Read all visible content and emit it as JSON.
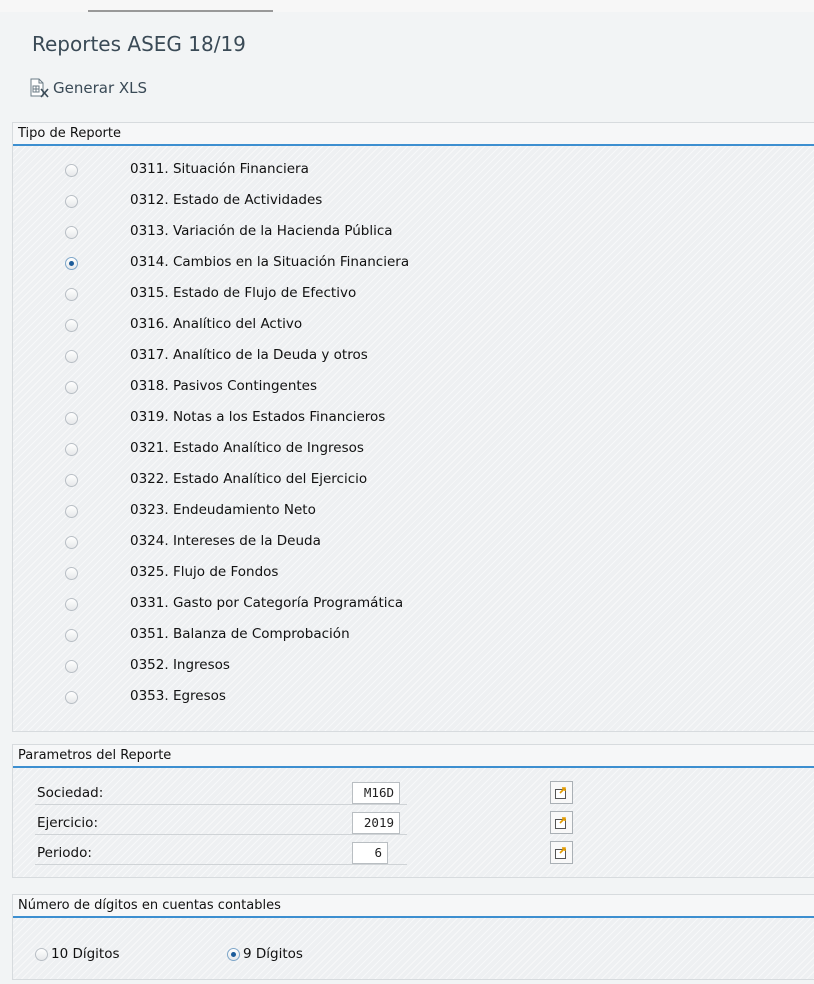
{
  "window": {
    "title": "Reportes ASEG 18/19"
  },
  "toolbar": {
    "generate_label": "Generar XLS",
    "icon": "excel-export-icon"
  },
  "report_type": {
    "title": "Tipo de Reporte",
    "selected": "0314",
    "options": [
      {
        "code": "0311",
        "label": "0311. Situación Financiera"
      },
      {
        "code": "0312",
        "label": "0312. Estado de Actividades"
      },
      {
        "code": "0313",
        "label": "0313. Variación de la Hacienda Pública"
      },
      {
        "code": "0314",
        "label": "0314. Cambios en la Situación Financiera"
      },
      {
        "code": "0315",
        "label": "0315. Estado de Flujo de Efectivo"
      },
      {
        "code": "0316",
        "label": "0316. Analítico del Activo"
      },
      {
        "code": "0317",
        "label": "0317. Analítico de la Deuda y otros"
      },
      {
        "code": "0318",
        "label": "0318. Pasivos Contingentes"
      },
      {
        "code": "0319",
        "label": "0319. Notas a los Estados Financieros"
      },
      {
        "code": "0321",
        "label": "0321. Estado Analítico de Ingresos"
      },
      {
        "code": "0322",
        "label": "0322. Estado Analítico del Ejercicio"
      },
      {
        "code": "0323",
        "label": "0323. Endeudamiento Neto"
      },
      {
        "code": "0324",
        "label": "0324. Intereses de la Deuda"
      },
      {
        "code": "0325",
        "label": "0325. Flujo de Fondos"
      },
      {
        "code": "0331",
        "label": "0331. Gasto por Categoría Programática"
      },
      {
        "code": "0351",
        "label": "0351. Balanza de Comprobación"
      },
      {
        "code": "0352",
        "label": "0352. Ingresos"
      },
      {
        "code": "0353",
        "label": "0353. Egresos"
      }
    ]
  },
  "parameters": {
    "title": "Parametros del Reporte",
    "sociedad": {
      "label": "Sociedad:",
      "value": "M16D"
    },
    "ejercicio": {
      "label": "Ejercicio:",
      "value": "2019"
    },
    "periodo": {
      "label": "Periodo:",
      "value": "6"
    }
  },
  "digits": {
    "title": "Número de dígitos en cuentas contables",
    "options": [
      {
        "label": "10 Dígitos",
        "checked": false
      },
      {
        "label": "9 Dígitos",
        "checked": true
      }
    ]
  },
  "colors": {
    "accent": "#3d8fd0",
    "title_text": "#3a4a56",
    "radio_dot": "#1c5c9a"
  }
}
